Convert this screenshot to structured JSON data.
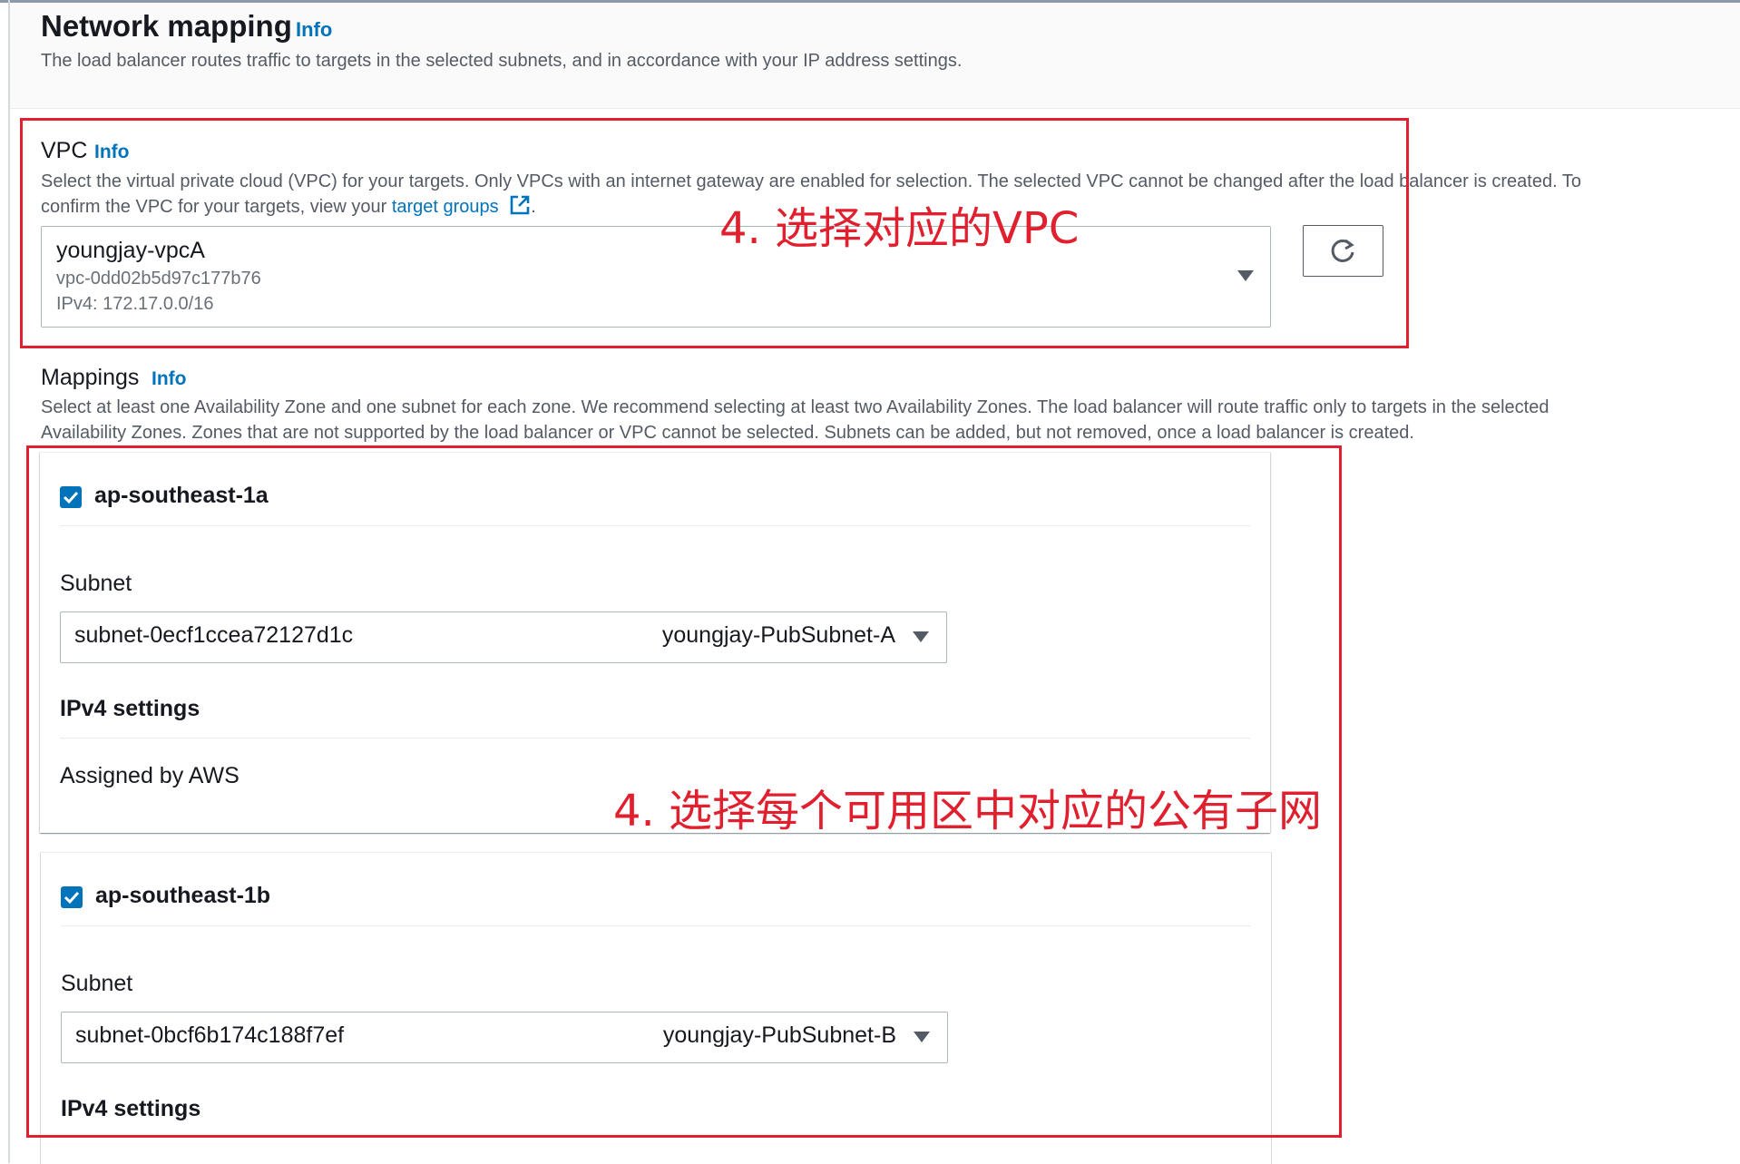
{
  "network_mapping": {
    "title": "Network mapping",
    "info": "Info",
    "description": "The load balancer routes traffic to targets in the selected subnets, and in accordance with your IP address settings."
  },
  "vpc": {
    "label": "VPC",
    "info": "Info",
    "description_line1": "Select the virtual private cloud (VPC) for your targets. Only VPCs with an internet gateway are enabled for selection. The selected VPC cannot be changed after the load balancer is created. To",
    "description_line2_prefix": "confirm the VPC for your targets, view your ",
    "description_link": "target groups",
    "description_line2_suffix": ".",
    "selected_name": "youngjay-vpcA",
    "selected_id": "vpc-0dd02b5d97c177b76",
    "selected_cidr": "IPv4: 172.17.0.0/16",
    "refresh_icon": "refresh-icon"
  },
  "mappings": {
    "label": "Mappings",
    "info": "Info",
    "description_line1": "Select at least one Availability Zone and one subnet for each zone. We recommend selecting at least two Availability Zones. The load balancer will route traffic only to targets in the selected",
    "description_line2": "Availability Zones. Zones that are not supported by the load balancer or VPC cannot be selected. Subnets can be added, but not removed, once a load balancer is created.",
    "zones": [
      {
        "name": "ap-southeast-1a",
        "checked": true,
        "subnet_label": "Subnet",
        "subnet_id": "subnet-0ecf1ccea72127d1c",
        "subnet_name": "youngjay-PubSubnet-A",
        "ipv4_title": "IPv4 settings",
        "ipv4_value": "Assigned by AWS"
      },
      {
        "name": "ap-southeast-1b",
        "checked": true,
        "subnet_label": "Subnet",
        "subnet_id": "subnet-0bcf6b174c188f7ef",
        "subnet_name": "youngjay-PubSubnet-B",
        "ipv4_title": "IPv4 settings"
      }
    ]
  },
  "annotations": {
    "vpc_note": "4. 选择对应的VPC",
    "subnet_note": "4. 选择每个可用区中对应的公有子网",
    "color": "#e0202e"
  },
  "colors": {
    "link": "#0073bb",
    "checkbox": "#0073bb"
  }
}
